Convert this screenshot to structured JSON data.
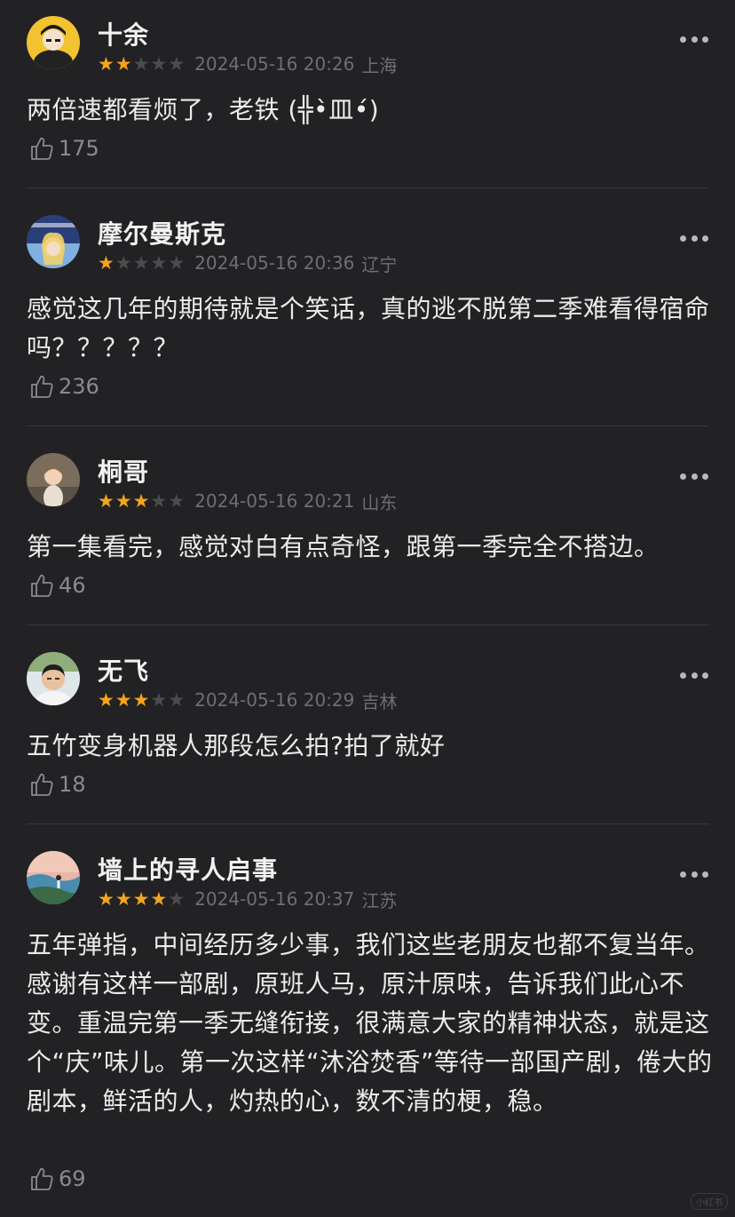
{
  "comments": [
    {
      "user": "十余",
      "rating": 2,
      "datetime": "2024-05-16 20:26",
      "location": "上海",
      "text": "两倍速都看烦了，老铁 (╬•̀皿•́)",
      "likes": "175",
      "avatar_icon": "avatar-cartoon-icon"
    },
    {
      "user": "摩尔曼斯克",
      "rating": 1,
      "datetime": "2024-05-16 20:36",
      "location": "辽宁",
      "text": "感觉这几年的期待就是个笑话，真的逃不脱第二季难看得宿命吗？？？？？",
      "likes": "236",
      "avatar_icon": "avatar-princess-icon"
    },
    {
      "user": "桐哥",
      "rating": 3,
      "datetime": "2024-05-16 20:21",
      "location": "山东",
      "text": "第一集看完，感觉对白有点奇怪，跟第一季完全不搭边。",
      "likes": "46",
      "avatar_icon": "avatar-child-icon"
    },
    {
      "user": "无飞",
      "rating": 3,
      "datetime": "2024-05-16 20:29",
      "location": "吉林",
      "text": "五竹变身机器人那段怎么拍?拍了就好",
      "likes": "18",
      "avatar_icon": "avatar-person-icon"
    },
    {
      "user": "墙上的寻人启事",
      "rating": 4,
      "datetime": "2024-05-16 20:37",
      "location": "江苏",
      "text": "五年弹指，中间经历多少事，我们这些老朋友也都不复当年。感谢有这样一部剧，原班人马，原汁原味，告诉我们此心不变。重温完第一季无缝衔接，很满意大家的精神状态，就是这个“庆”味儿。第一次这样“沐浴焚香”等待一部国产剧，倦大的剧本，鲜活的人，灼热的心，数不清的梗，稳。",
      "likes": "69",
      "avatar_icon": "avatar-landscape-icon"
    }
  ],
  "colors": {
    "background": "#222225",
    "star_filled": "#f4a51c",
    "star_empty": "#4c4c50",
    "meta_text": "#6e6e73"
  },
  "icons": {
    "more": "more-dots-icon",
    "like": "thumbs-up-icon",
    "star": "star-icon"
  },
  "watermark": "小红书"
}
